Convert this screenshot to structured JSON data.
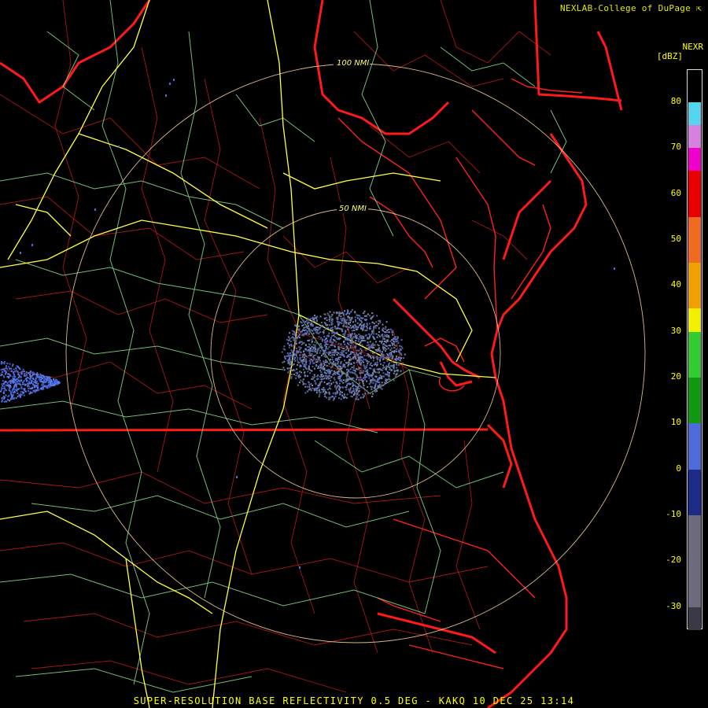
{
  "credit_text": "NEXLAB-College of DuPage",
  "credit_icon": "cursor-arrow-icon",
  "product_label": "SUPER-RESOLUTION BASE REFLECTIVITY 0.5 DEG - KAKQ 10 DEC 25 13:14",
  "legend": {
    "product": "NEXR",
    "units": "[dBZ]",
    "ticks": [
      "80",
      "70",
      "60",
      "50",
      "40",
      "30",
      "20",
      "10",
      "0",
      "-10",
      "-20",
      "-30"
    ],
    "segments": [
      {
        "dbz_from": 80,
        "dbz_to": 75,
        "color": "#55d4ee"
      },
      {
        "dbz_from": 75,
        "dbz_to": 70,
        "color": "#d780e0"
      },
      {
        "dbz_from": 70,
        "dbz_to": 65,
        "color": "#ee00cc"
      },
      {
        "dbz_from": 65,
        "dbz_to": 55,
        "color": "#e80000"
      },
      {
        "dbz_from": 55,
        "dbz_to": 45,
        "color": "#f06a20"
      },
      {
        "dbz_from": 45,
        "dbz_to": 35,
        "color": "#f0a000"
      },
      {
        "dbz_from": 35,
        "dbz_to": 30,
        "color": "#f0f000"
      },
      {
        "dbz_from": 30,
        "dbz_to": 20,
        "color": "#33cc33"
      },
      {
        "dbz_from": 20,
        "dbz_to": 10,
        "color": "#119911"
      },
      {
        "dbz_from": 10,
        "dbz_to": 0,
        "color": "#4d6bd9"
      },
      {
        "dbz_from": 0,
        "dbz_to": -10,
        "color": "#1c2a88"
      },
      {
        "dbz_from": -10,
        "dbz_to": -30,
        "color": "#6b6b7d"
      },
      {
        "dbz_from": -30,
        "dbz_to": -35,
        "color": "#3a3a46"
      }
    ]
  },
  "range_rings": [
    {
      "label": "100 NMI"
    },
    {
      "label": "50 NMI"
    }
  ],
  "colors": {
    "state_border": "#ff1a1a",
    "county_border": "#b81a1a",
    "highway": "#ffff44",
    "road": "#88dd88",
    "range_ring": "#ffd8a0",
    "echo_light": "#7788b0",
    "echo_blue": "#3f5fd0"
  }
}
